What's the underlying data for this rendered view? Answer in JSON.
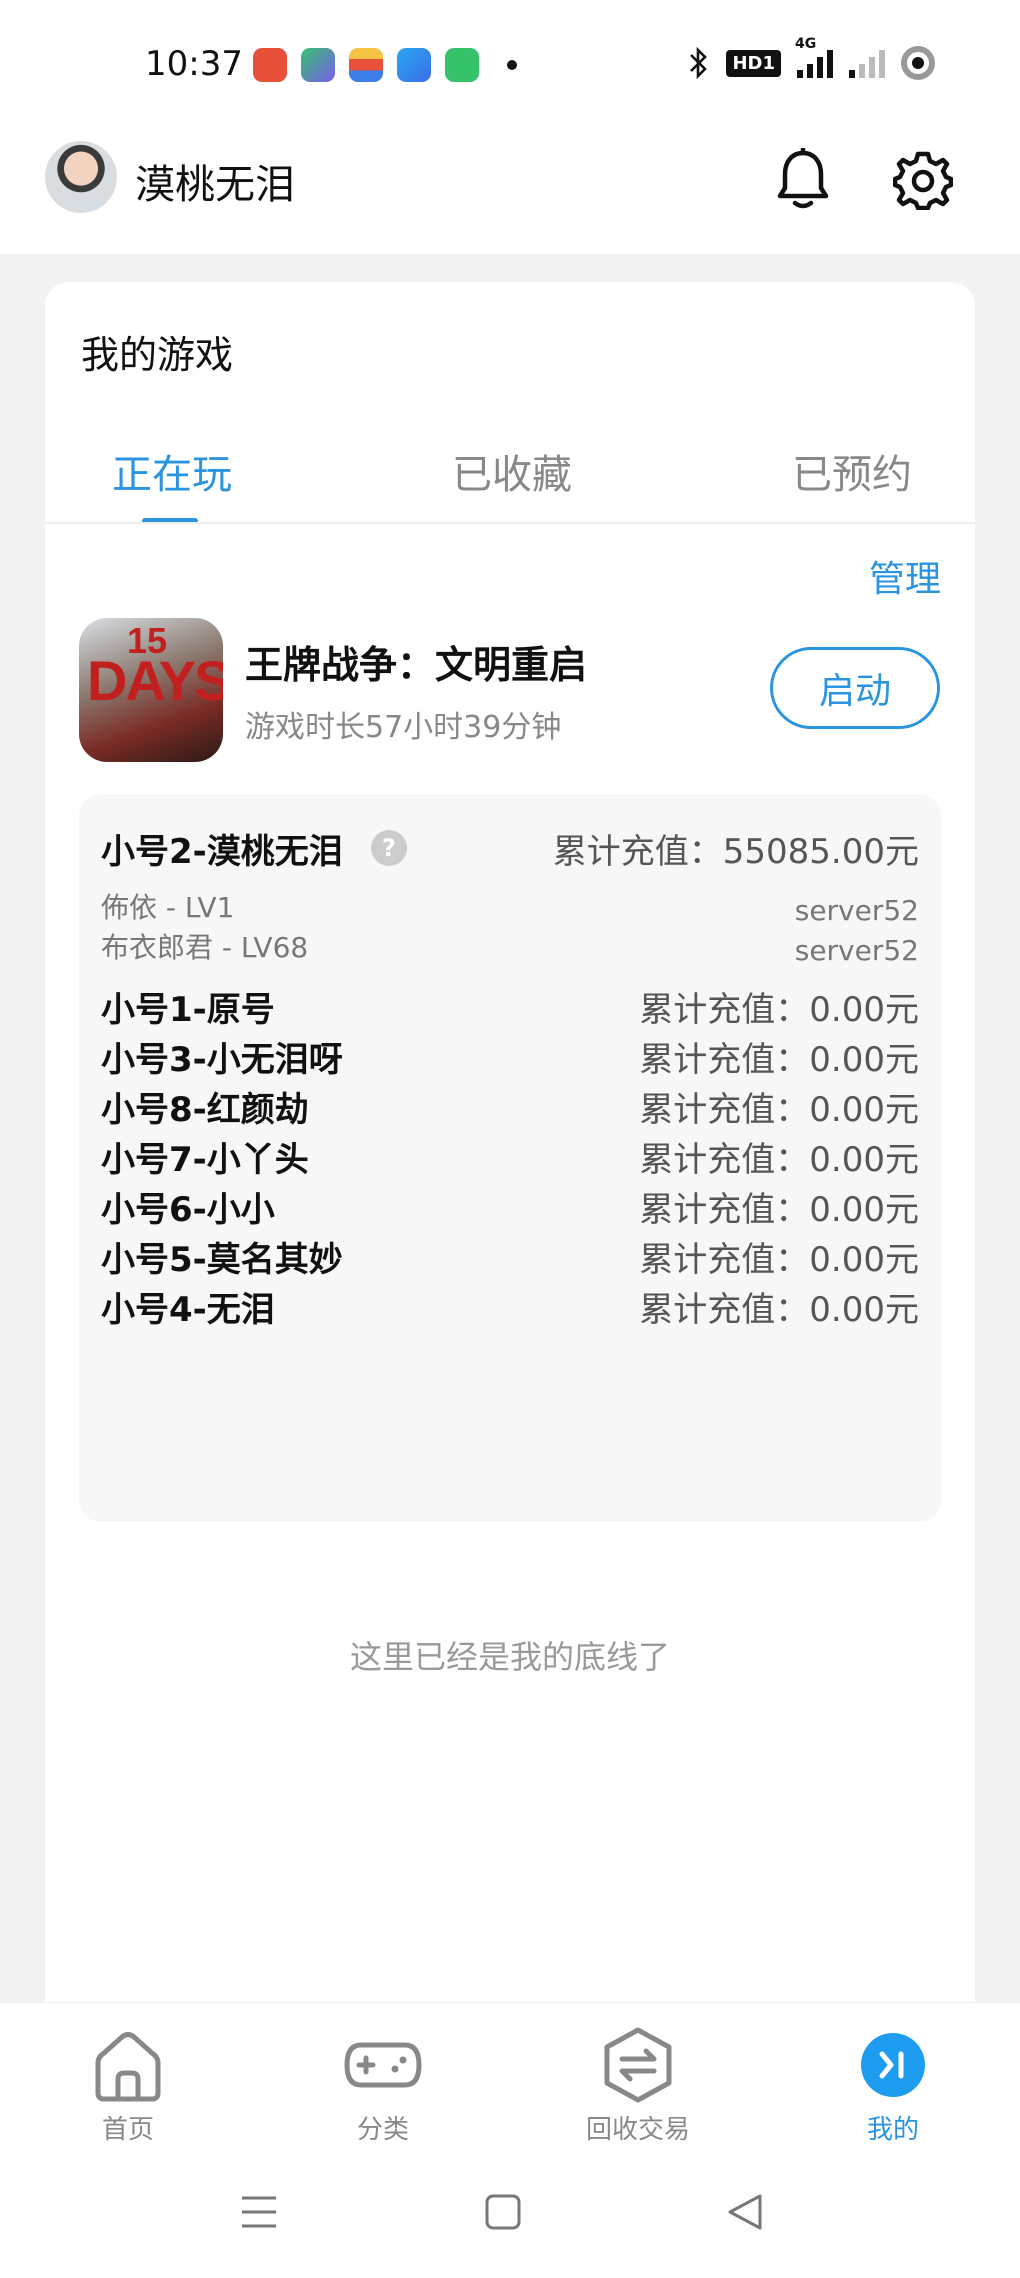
{
  "status": {
    "time": "10:37",
    "hd_label": "HD1",
    "net_label": "4G"
  },
  "header": {
    "username": "漠桃无泪"
  },
  "my_games": {
    "title": "我的游戏",
    "tabs": [
      {
        "label": "正在玩",
        "active": true
      },
      {
        "label": "已收藏",
        "active": false
      },
      {
        "label": "已预约",
        "active": false
      }
    ],
    "manage_label": "管理"
  },
  "game": {
    "name": "王牌战争：文明重启",
    "playtime": "游戏时长57小时39分钟",
    "launch_label": "启动",
    "icon_text": "DAYS",
    "icon_number": "15"
  },
  "accounts": [
    {
      "name": "小号2-漠桃无泪",
      "recharge": "累计充值：55085.00元",
      "has_help": true,
      "roles": [
        {
          "name": "佈依 - LV1",
          "server": "server52"
        },
        {
          "name": "布衣郎君 - LV68",
          "server": "server52"
        }
      ]
    },
    {
      "name": "小号1-原号",
      "recharge": "累计充值：0.00元"
    },
    {
      "name": "小号3-小无泪呀",
      "recharge": "累计充值：0.00元"
    },
    {
      "name": "小号8-红颜劫",
      "recharge": "累计充值：0.00元"
    },
    {
      "name": "小号7-小丫头",
      "recharge": "累计充值：0.00元"
    },
    {
      "name": "小号6-小小",
      "recharge": "累计充值：0.00元"
    },
    {
      "name": "小号5-莫名其妙",
      "recharge": "累计充值：0.00元"
    },
    {
      "name": "小号4-无泪",
      "recharge": "累计充值：0.00元"
    }
  ],
  "bottom_note": "这里已经是我的底线了",
  "nav": [
    {
      "label": "首页",
      "icon": "home-icon",
      "active": false
    },
    {
      "label": "分类",
      "icon": "gamepad-icon",
      "active": false
    },
    {
      "label": "回收交易",
      "icon": "exchange-icon",
      "active": false
    },
    {
      "label": "我的",
      "icon": "profile-icon",
      "active": true
    }
  ],
  "colors": {
    "accent": "#2a94e0",
    "background": "#f2f2f2"
  }
}
